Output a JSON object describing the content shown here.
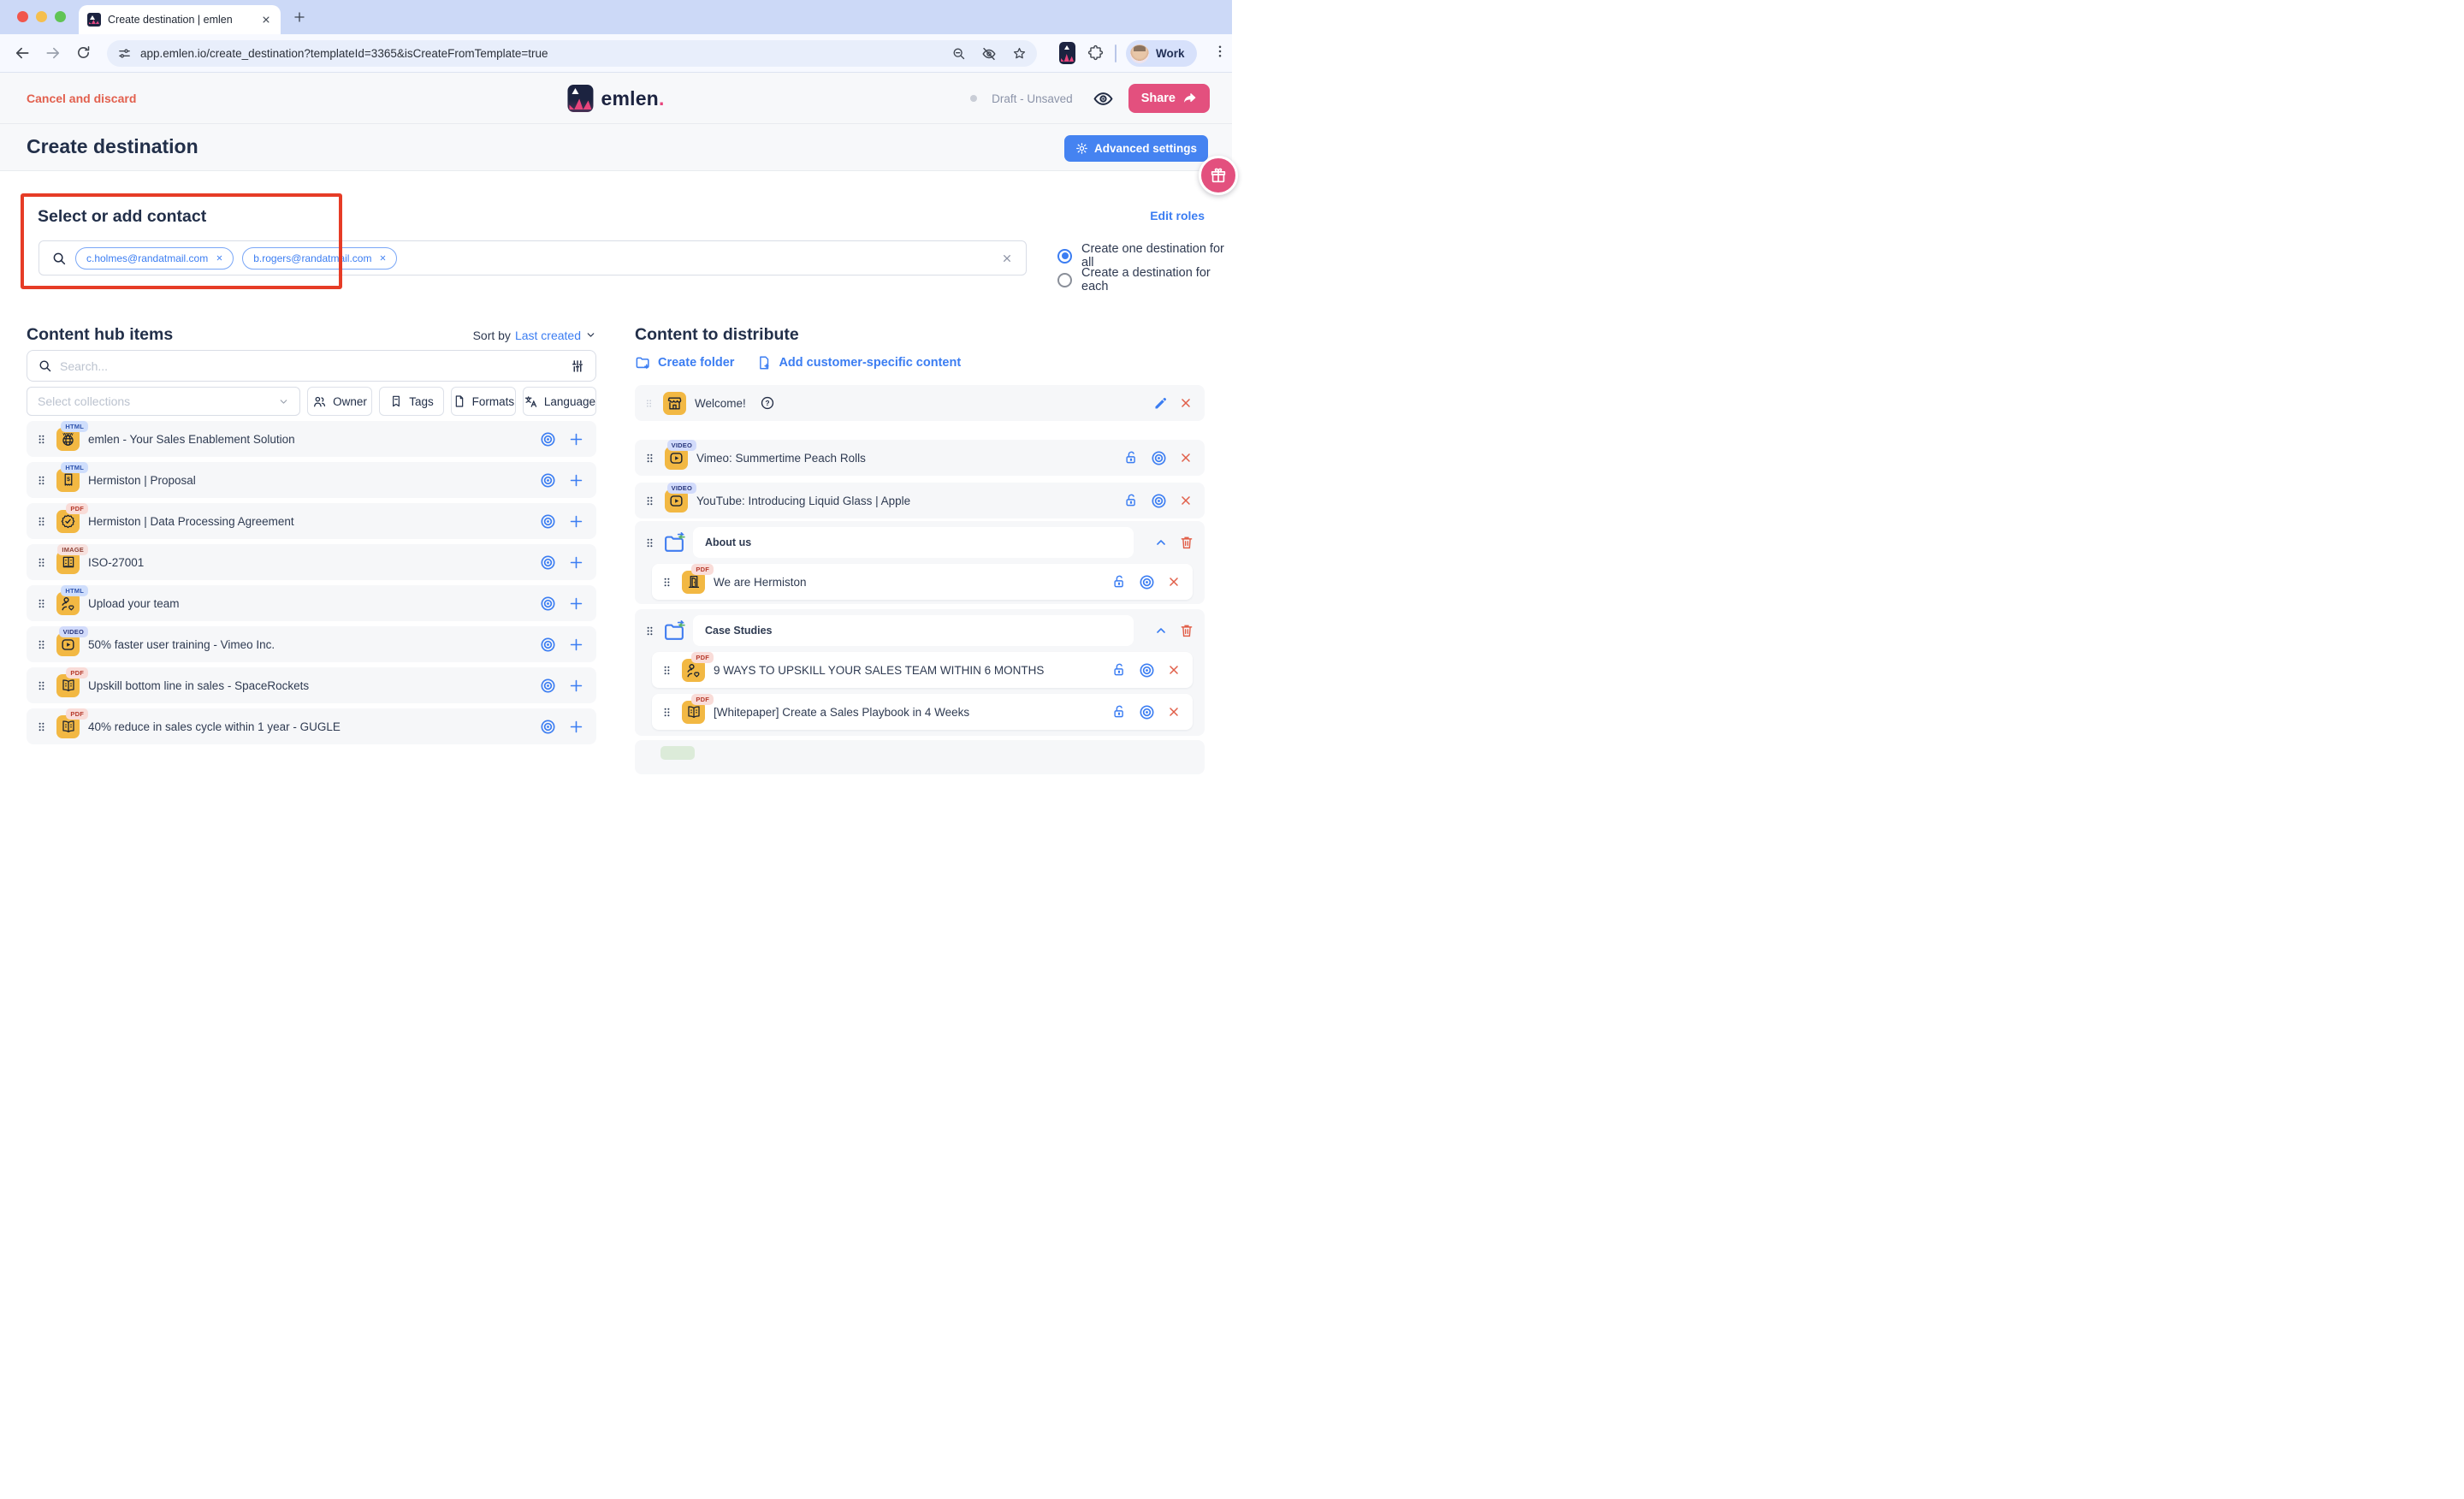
{
  "browser": {
    "tab_title": "Create destination | emlen",
    "url": "app.emlen.io/create_destination?templateId=3365&isCreateFromTemplate=true",
    "profile_label": "Work"
  },
  "header": {
    "cancel_label": "Cancel and discard",
    "logo_text": "emlen",
    "logo_dot": ".",
    "status": "Draft - Unsaved",
    "share_label": "Share"
  },
  "page": {
    "title": "Create destination",
    "advanced_settings_label": "Advanced settings"
  },
  "contact": {
    "heading": "Select or add contact",
    "chips": [
      {
        "email": "c.holmes@randatmail.com"
      },
      {
        "email": "b.rogers@randatmail.com"
      }
    ],
    "edit_roles_label": "Edit roles",
    "radio_all": "Create one destination for all",
    "radio_each": "Create a destination for each",
    "radio_selected": "Create one destination for all"
  },
  "hub": {
    "heading": "Content hub items",
    "sort_by_label": "Sort by",
    "sort_by_value": "Last created",
    "search_placeholder": "Search...",
    "collections_placeholder": "Select collections",
    "filters": [
      {
        "label": "Owner"
      },
      {
        "label": "Tags"
      },
      {
        "label": "Formats"
      },
      {
        "label": "Language"
      }
    ],
    "items": [
      {
        "title": "emlen - Your Sales Enablement Solution",
        "badge": "HTML"
      },
      {
        "title": "Hermiston | Proposal",
        "badge": "HTML"
      },
      {
        "title": "Hermiston | Data Processing Agreement",
        "badge": "PDF"
      },
      {
        "title": "ISO-27001",
        "badge": "IMAGE"
      },
      {
        "title": "Upload your team",
        "badge": "HTML"
      },
      {
        "title": "50% faster user training - Vimeo Inc.",
        "badge": "VIDEO"
      },
      {
        "title": "Upskill bottom line in sales - SpaceRockets",
        "badge": "PDF"
      },
      {
        "title": "40% reduce in sales cycle within 1 year - GUGLE",
        "badge": "PDF"
      }
    ]
  },
  "distribute": {
    "heading": "Content to distribute",
    "create_folder_label": "Create folder",
    "add_customer_label": "Add customer-specific content",
    "welcome_title": "Welcome!",
    "items": [
      {
        "title": "Vimeo: Summertime Peach Rolls",
        "badge": "VIDEO"
      },
      {
        "title": "YouTube: Introducing Liquid Glass | Apple",
        "badge": "VIDEO"
      }
    ],
    "folders": [
      {
        "name": "About us",
        "children": [
          {
            "title": "We are Hermiston",
            "badge": "PDF"
          }
        ]
      },
      {
        "name": "Case Studies",
        "children": [
          {
            "title": "9 WAYS TO UPSKILL YOUR SALES TEAM WITHIN 6 MONTHS",
            "badge": "PDF"
          },
          {
            "title": "[Whitepaper] Create a Sales Playbook in 4 Weeks",
            "badge": "PDF"
          }
        ]
      }
    ]
  },
  "colors": {
    "accent_blue": "#3b7df2",
    "brand_pink": "#e3507e",
    "coral_red": "#e15f49",
    "annotation_red": "#e63c26",
    "tile_yellow": "#f2b843",
    "navy_text": "#222f49"
  }
}
